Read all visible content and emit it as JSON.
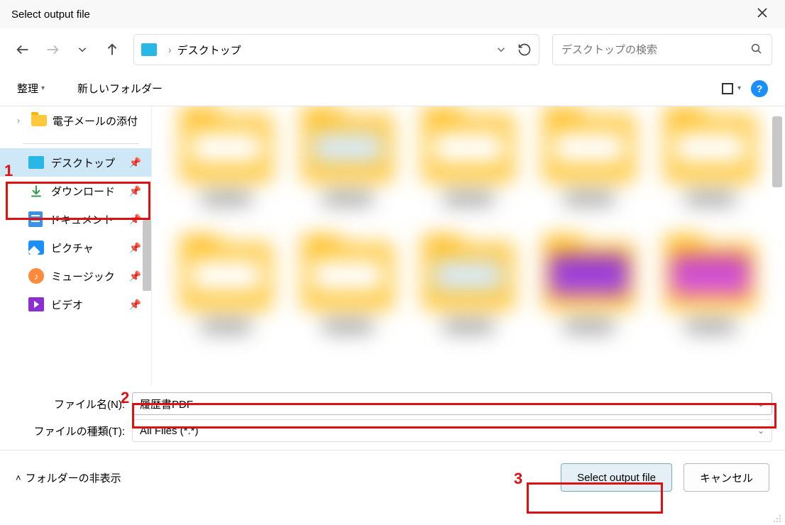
{
  "window": {
    "title": "Select output file"
  },
  "nav": {
    "location": "デスクトップ",
    "refresh_icon": "refresh-icon"
  },
  "search": {
    "placeholder": "デスクトップの検索"
  },
  "toolbar": {
    "organize": "整理",
    "new_folder": "新しいフォルダー",
    "help": "?"
  },
  "sidebar": {
    "treeItems": [
      {
        "label": "電子メールの添付"
      }
    ],
    "quickAccess": [
      {
        "label": "デスクトップ",
        "icon": "desktop",
        "selected": true
      },
      {
        "label": "ダウンロード",
        "icon": "download",
        "selected": false
      },
      {
        "label": "ドキュメント",
        "icon": "doc",
        "selected": false
      },
      {
        "label": "ピクチャ",
        "icon": "pic",
        "selected": false
      },
      {
        "label": "ミュージック",
        "icon": "music",
        "selected": false
      },
      {
        "label": "ビデオ",
        "icon": "video",
        "selected": false
      }
    ]
  },
  "fields": {
    "filename_label": "ファイル名(N):",
    "filename_value": "履歴書PDF",
    "filetype_label": "ファイルの種類(T):",
    "filetype_value": "All Files (*.*)"
  },
  "footer": {
    "hide_folders": "フォルダーの非表示",
    "primary_button": "Select output file",
    "cancel_button": "キャンセル"
  },
  "annotations": {
    "n1": "1",
    "n2": "2",
    "n3": "3"
  }
}
